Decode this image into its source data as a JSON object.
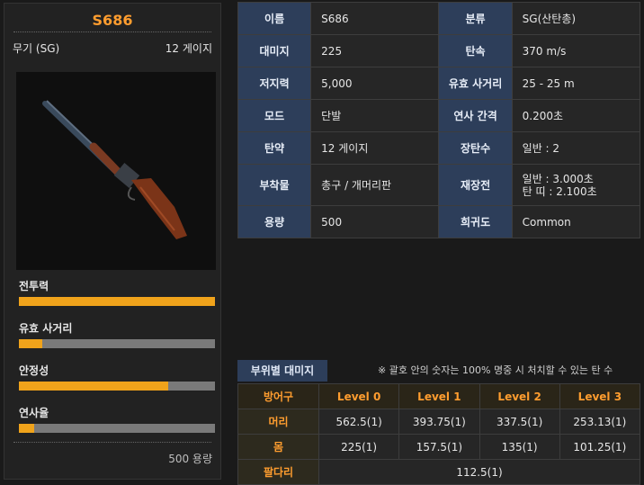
{
  "weapon": {
    "name": "S686",
    "category": "무기 (SG)",
    "ammo": "12 게이지",
    "capacity": "500 용량",
    "stats": [
      {
        "label": "전투력",
        "level": 1.0
      },
      {
        "label": "유효 사거리",
        "level": 0.12
      },
      {
        "label": "안정성",
        "level": 0.76
      },
      {
        "label": "연사율",
        "level": 0.08
      }
    ]
  },
  "info": {
    "rows": [
      [
        "이름",
        "S686",
        "분류",
        "SG(산탄총)"
      ],
      [
        "대미지",
        "225",
        "탄속",
        "370 m/s"
      ],
      [
        "저지력",
        "5,000",
        "유효 사거리",
        "25 - 25 m"
      ],
      [
        "모드",
        "단발",
        "연사 간격",
        "0.200초"
      ],
      [
        "탄약",
        "12 게이지",
        "장탄수",
        "일반 : 2"
      ]
    ],
    "attach_label": "부착물",
    "attach_value": "총구 / 개머리판",
    "reload_label": "재장전",
    "reload_line1": "일반 : 3.000초",
    "reload_line2": "탄 띠 : 2.100초",
    "last": [
      "용량",
      "500",
      "희귀도",
      "Common"
    ]
  },
  "damage": {
    "tab": "부위별 대미지",
    "note": "※ 괄호 안의 숫자는 100% 명중 시 처치할 수 있는 탄 수",
    "headers": [
      "방어구",
      "Level 0",
      "Level 1",
      "Level 2",
      "Level 3"
    ],
    "rows": [
      [
        "머리",
        "562.5(1)",
        "393.75(1)",
        "337.5(1)",
        "253.13(1)"
      ],
      [
        "몸",
        "225(1)",
        "157.5(1)",
        "135(1)",
        "101.25(1)"
      ]
    ],
    "limb_label": "팔다리",
    "limb_value": "112.5(1)"
  }
}
